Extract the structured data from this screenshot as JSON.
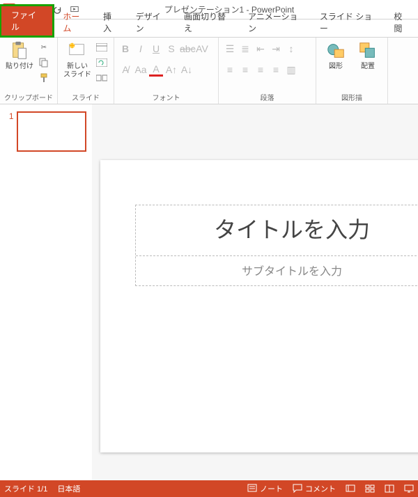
{
  "title": "プレゼンテーション1 - PowerPoint",
  "tabs": {
    "file": "ファイル",
    "home": "ホーム",
    "insert": "挿入",
    "design": "デザイン",
    "transitions": "画面切り替え",
    "animations": "アニメーション",
    "slideshow": "スライド ショー",
    "review": "校閲"
  },
  "groups": {
    "clipboard": {
      "paste": "貼り付け",
      "label": "クリップボード"
    },
    "slides": {
      "new_slide": "新しい\nスライド",
      "label": "スライド"
    },
    "font": {
      "label": "フォント"
    },
    "paragraph": {
      "label": "段落"
    },
    "drawing": {
      "shapes": "図形",
      "arrange": "配置",
      "label": "図形描"
    }
  },
  "thumb": {
    "n1": "1"
  },
  "slide": {
    "title_placeholder": "タイトルを入力",
    "subtitle_placeholder": "サブタイトルを入力"
  },
  "status": {
    "slide_count": "スライド 1/1",
    "language": "日本語",
    "notes": "ノート",
    "comments": "コメント"
  }
}
